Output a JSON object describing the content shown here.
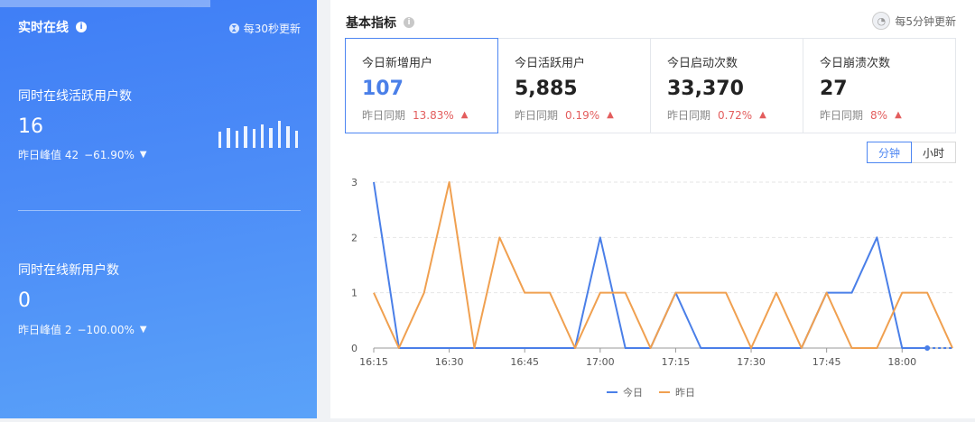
{
  "realtime": {
    "title": "实时在线",
    "update_text": "每30秒更新",
    "active": {
      "label": "同时在线活跃用户数",
      "value": "16",
      "peak_label": "昨日峰值 42",
      "change": "−61.90%"
    },
    "new_users": {
      "label": "同时在线新用户数",
      "value": "0",
      "peak_label": "昨日峰值 2",
      "change": "−100.00%"
    },
    "mini_bars": [
      0.55,
      0.7,
      0.6,
      0.75,
      0.65,
      0.8,
      0.7,
      0.95,
      0.75,
      0.6
    ]
  },
  "basic": {
    "title": "基本指标",
    "update_text": "每5分钟更新",
    "cards": [
      {
        "label": "今日新增用户",
        "value": "107",
        "compare": "昨日同期",
        "pct": "13.83%"
      },
      {
        "label": "今日活跃用户",
        "value": "5,885",
        "compare": "昨日同期",
        "pct": "0.19%"
      },
      {
        "label": "今日启动次数",
        "value": "33,370",
        "compare": "昨日同期",
        "pct": "0.72%"
      },
      {
        "label": "今日崩溃次数",
        "value": "27",
        "compare": "昨日同期",
        "pct": "8%"
      }
    ],
    "toggle": {
      "minute": "分钟",
      "hour": "小时"
    }
  },
  "colors": {
    "today": "#4a7fe8",
    "yesterday": "#f0a050"
  },
  "chart_data": {
    "type": "line",
    "x": [
      "16:15",
      "16:20",
      "16:25",
      "16:30",
      "16:35",
      "16:40",
      "16:45",
      "16:50",
      "16:55",
      "17:00",
      "17:05",
      "17:10",
      "17:15",
      "17:20",
      "17:25",
      "17:30",
      "17:35",
      "17:40",
      "17:45",
      "17:50",
      "17:55",
      "18:00",
      "18:05",
      "18:10"
    ],
    "xticks": [
      "16:15",
      "16:30",
      "16:45",
      "17:00",
      "17:15",
      "17:30",
      "17:45",
      "18:00"
    ],
    "yticks": [
      0,
      1,
      2,
      3
    ],
    "ylim": [
      0,
      3
    ],
    "series": [
      {
        "name": "今日",
        "values": [
          3,
          0,
          0,
          0,
          0,
          0,
          0,
          0,
          0,
          2,
          0,
          0,
          1,
          0,
          0,
          0,
          0,
          0,
          1,
          1,
          2,
          0,
          0,
          null
        ]
      },
      {
        "name": "昨日",
        "values": [
          1,
          0,
          1,
          3,
          0,
          2,
          1,
          1,
          0,
          1,
          1,
          0,
          1,
          1,
          1,
          0,
          1,
          0,
          1,
          0,
          0,
          1,
          1,
          0
        ]
      }
    ],
    "legend": "bottom"
  }
}
